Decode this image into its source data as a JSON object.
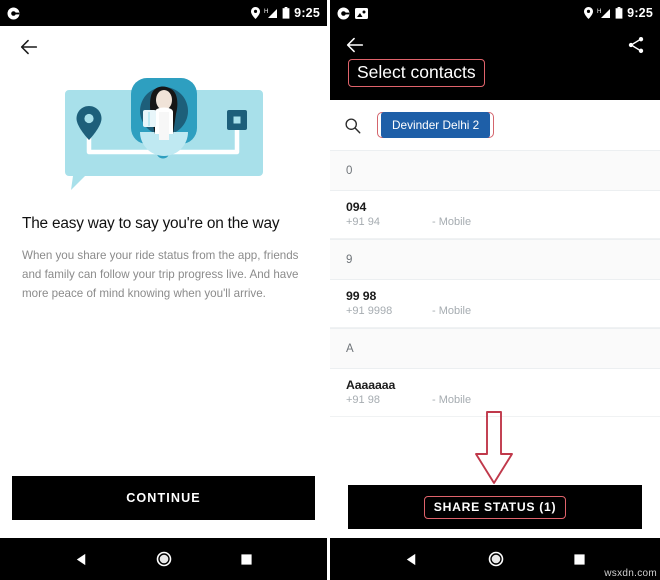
{
  "left": {
    "statusbar": {
      "time": "9:25",
      "icons": [
        "location-pin",
        "signal-h",
        "battery"
      ],
      "app_icon": "app-dot-icon"
    },
    "back_label": "back-arrow",
    "illustration": {
      "name": "ride-status-illustration",
      "bubble_color": "#a8e0ea",
      "avatar_tile_color": "#2e9fc0",
      "pin_color": "#1d5f7a"
    },
    "title": "The easy way to say you're on the way",
    "description": "When you share your ride status from the app, friends and family can follow your trip progress live. And have more peace of mind knowing when you'll arrive.",
    "continue_label": "CONTINUE",
    "nav": {
      "back": "nav-back",
      "home": "nav-home",
      "recents": "nav-recents"
    }
  },
  "right": {
    "statusbar": {
      "time": "9:25",
      "icons": [
        "location-pin",
        "signal-h",
        "battery"
      ],
      "app_icons": [
        "app-dot-icon",
        "image-icon"
      ]
    },
    "appbar": {
      "title": "Select contacts",
      "share_icon": "share-icon",
      "back_icon": "back-arrow-icon"
    },
    "search": {
      "icon": "search-icon",
      "chip": "Devinder Delhi 2"
    },
    "contacts": [
      {
        "type": "section",
        "label": "0"
      },
      {
        "type": "contact",
        "name": "094",
        "number": "+91 94",
        "phone_type": "- Mobile"
      },
      {
        "type": "section",
        "label": "9"
      },
      {
        "type": "contact",
        "name": "99 98",
        "number": "+91 9998",
        "phone_type": "- Mobile"
      },
      {
        "type": "section",
        "label": "A"
      },
      {
        "type": "contact",
        "name": "Aaaaaaa",
        "number": "+91 98",
        "phone_type": "- Mobile"
      }
    ],
    "share_button": "SHARE STATUS (1)",
    "annotations": {
      "title_box_color": "#e0636b",
      "chip_box_color": "#d4656d",
      "arrow_color": "#c0394b",
      "button_box_color": "#d4656d"
    },
    "nav": {
      "back": "nav-back",
      "home": "nav-home",
      "recents": "nav-recents"
    },
    "watermark": "wsxdn.com"
  }
}
